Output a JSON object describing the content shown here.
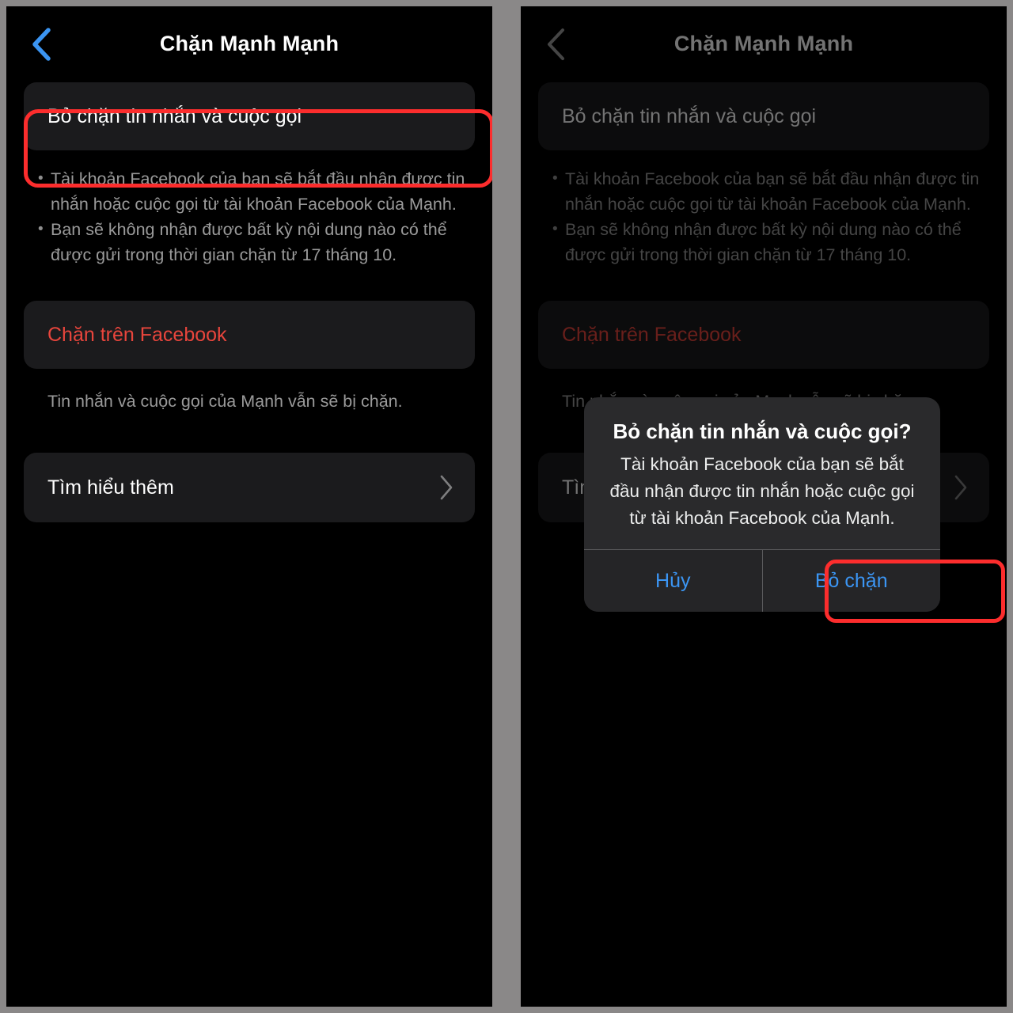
{
  "meta": {
    "accent_blue": "#3b95f3",
    "danger_red": "#e8453c",
    "annotation_red": "#fc2d2d",
    "card_bg": "#1b1b1d",
    "screen_bg": "#000000",
    "frame_gray": "#8a8888"
  },
  "screens": [
    {
      "id": "left",
      "nav": {
        "back_icon": "chevron-left-icon",
        "title": "Chặn Mạnh Mạnh"
      },
      "unblock_card": {
        "label": "Bỏ chặn tin nhắn và cuộc gọi"
      },
      "bullets": [
        {
          "dot": "•",
          "text": "Tài khoản Facebook của bạn sẽ bắt đầu nhận được tin nhắn hoặc cuộc gọi từ tài khoản Facebook của Mạnh."
        },
        {
          "dot": "•",
          "text": "Bạn sẽ không nhận được bất kỳ nội dung nào có thể được gửi trong thời gian chặn từ 17 tháng 10."
        }
      ],
      "block_card": {
        "label": "Chặn trên Facebook"
      },
      "block_helper": "Tin nhắn và cuộc gọi của Mạnh vẫn sẽ bị chặn.",
      "learn_more": {
        "label": "Tìm hiểu thêm",
        "chevron_icon": "chevron-right-icon"
      }
    },
    {
      "id": "right",
      "nav": {
        "back_icon": "chevron-left-icon",
        "title": "Chặn Mạnh Mạnh"
      },
      "unblock_card": {
        "label": "Bỏ chặn tin nhắn và cuộc gọi"
      },
      "bullets": [
        {
          "dot": "•",
          "text": "Tài khoản Facebook của bạn sẽ bắt đầu nhận được tin nhắn hoặc cuộc gọi từ tài khoản Facebook của Mạnh."
        },
        {
          "dot": "•",
          "text": "Bạn sẽ không nhận được bất kỳ nội dung nào có thể được gửi trong thời gian chặn từ 17 tháng 10."
        }
      ],
      "block_card": {
        "label": "Chặn trên Facebook"
      },
      "block_helper": "Tin nhắn và cuộc gọi của Mạnh vẫn sẽ bị chặn.",
      "learn_more": {
        "label": "Tìm hiểu thêm",
        "chevron_icon": "chevron-right-icon"
      }
    }
  ],
  "dialog": {
    "title": "Bỏ chặn tin nhắn và cuộc gọi?",
    "message": "Tài khoản Facebook của bạn sẽ bắt đầu nhận được tin nhắn hoặc cuộc gọi từ tài khoản Facebook của Mạnh.",
    "cancel_label": "Hủy",
    "confirm_label": "Bỏ chặn"
  }
}
